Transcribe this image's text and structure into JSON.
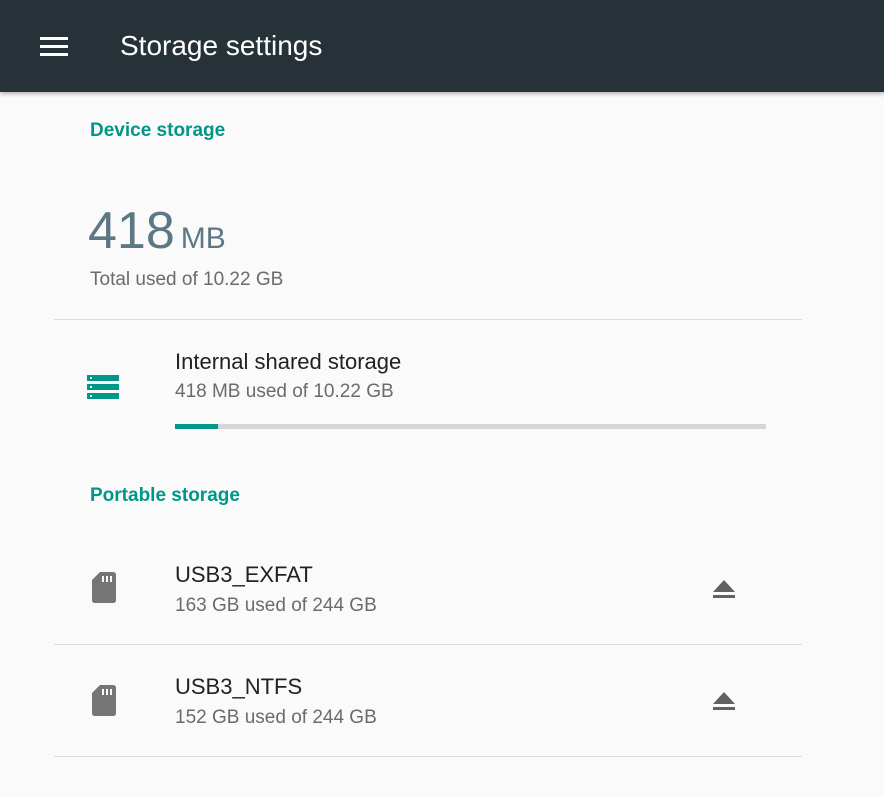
{
  "appbar": {
    "title": "Storage settings",
    "menu_icon": "hamburger-menu-icon",
    "background": "#263238"
  },
  "device_storage": {
    "header": "Device storage",
    "used_amount": "418",
    "used_unit": "MB",
    "total_text": "Total used of 10.22 GB",
    "internal": {
      "icon": "storage-list-icon",
      "title": "Internal shared storage",
      "subtitle": "418 MB used of 10.22 GB",
      "used_fraction": 0.072
    }
  },
  "portable_storage": {
    "header": "Portable storage",
    "devices": [
      {
        "icon": "sd-card-icon",
        "name": "USB3_EXFAT",
        "usage": "163 GB used of 244 GB",
        "action_icon": "eject-icon"
      },
      {
        "icon": "sd-card-icon",
        "name": "USB3_NTFS",
        "usage": "152 GB used of 244 GB",
        "action_icon": "eject-icon"
      }
    ]
  },
  "colors": {
    "accent": "#009688",
    "appbar": "#263238",
    "big_number": "#5e7784",
    "background": "#fafafa"
  }
}
